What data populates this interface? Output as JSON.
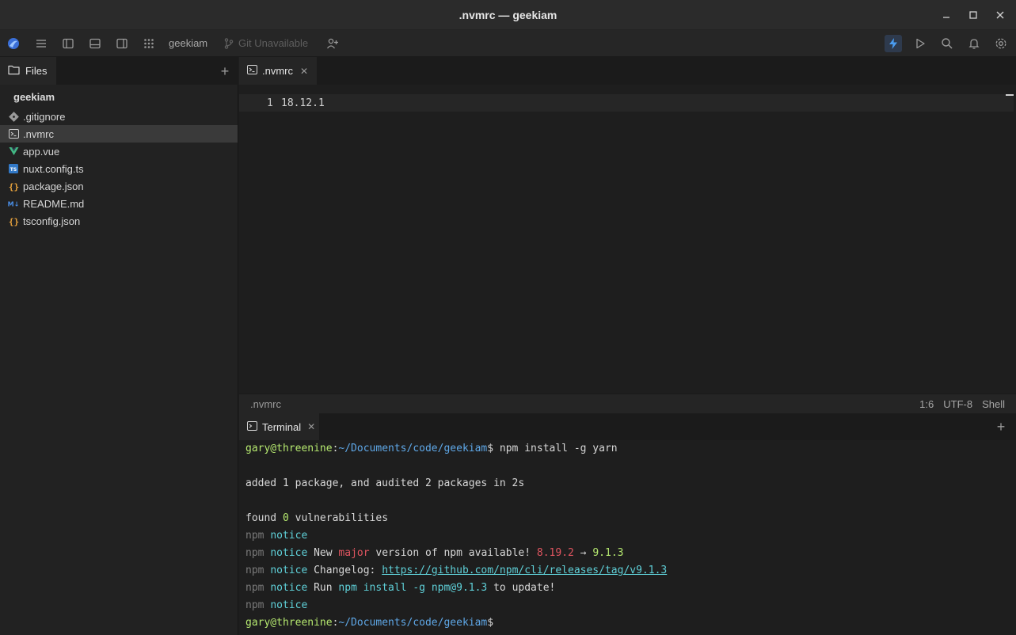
{
  "window": {
    "title": ".nvmrc — geekiam",
    "controls": [
      "minimize-icon",
      "maximize-icon",
      "close-icon"
    ]
  },
  "toolbar": {
    "project_name": "geekiam",
    "git_status": "Git Unavailable"
  },
  "sidebar": {
    "tab_label": "Files",
    "root_folder": "geekiam",
    "files": [
      {
        "name": ".gitignore",
        "icon": "git-icon",
        "color": "#9a9a9a",
        "selected": false
      },
      {
        "name": ".nvmrc",
        "icon": "terminal-file-icon",
        "color": "#cfcfcf",
        "selected": true
      },
      {
        "name": "app.vue",
        "icon": "vue-icon",
        "color": "#42b883",
        "selected": false
      },
      {
        "name": "nuxt.config.ts",
        "icon": "typescript-icon",
        "color": "#3178c6",
        "selected": false
      },
      {
        "name": "package.json",
        "icon": "json-icon",
        "color": "#e8a33d",
        "selected": false
      },
      {
        "name": "README.md",
        "icon": "markdown-icon",
        "color": "#4a8fe8",
        "selected": false
      },
      {
        "name": "tsconfig.json",
        "icon": "json-icon",
        "color": "#e8a33d",
        "selected": false
      }
    ]
  },
  "editor": {
    "tab_label": ".nvmrc",
    "line_number": "1",
    "line_text": "18.12.1"
  },
  "statusbar": {
    "file": ".nvmrc",
    "position": "1:6",
    "encoding": "UTF-8",
    "language": "Shell"
  },
  "terminal": {
    "tab_label": "Terminal",
    "prompt_user": "gary@threenine",
    "prompt_path": "~/Documents/code/geekiam",
    "command": " npm install -g yarn",
    "out_added": "added 1 package, and audited 2 packages in 2s",
    "out_found_pre": "found ",
    "out_found_zero": "0",
    "out_found_post": " vulnerabilities",
    "npm": "npm",
    "notice": "notice",
    "new_pre": " New ",
    "new_major": "major",
    "new_mid": " version of npm available! ",
    "old_version": "8.19.2",
    "arrow": " → ",
    "new_version": "9.1.3",
    "changelog_label": " Changelog: ",
    "changelog_url": "https://github.com/npm/cli/releases/tag/v9.1.3",
    "run_label": " Run ",
    "run_cmd": "npm install -g npm@9.1.3",
    "run_post": " to update!",
    "colors": {
      "user": "#b5e86f",
      "path": "#5fa8e8",
      "notice": "#5fd0d8",
      "major": "#e05560"
    }
  }
}
